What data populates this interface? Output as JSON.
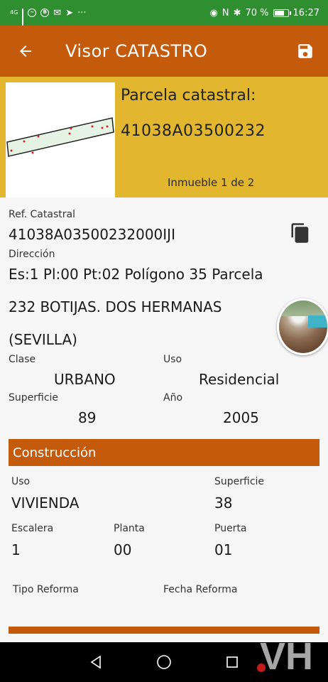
{
  "status_bar": {
    "network": "4G",
    "battery_percent": "70 %",
    "time": "16:27"
  },
  "app_bar": {
    "title": "Visor CATASTRO",
    "back_icon": "arrow-left-icon",
    "save_icon": "save-icon",
    "color": "#c35a0c"
  },
  "parcel": {
    "title": "Parcela catastral:",
    "code": "41038A03500232",
    "inmueble": "Inmueble 1 de 2",
    "header_color": "#e2b62f"
  },
  "details": {
    "ref_label": "Ref. Catastral",
    "ref_value": "41038A03500232000IJI",
    "direccion_label": "Dirección",
    "direccion_line1": "Es:1 Pl:00 Pt:02 Polígono 35 Parcela",
    "direccion_line2": "232 BOTIJAS. DOS HERMANAS",
    "direccion_line3": "(SEVILLA)",
    "clase_label": "Clase",
    "clase_value": "URBANO",
    "uso_label": "Uso",
    "uso_value": "Residencial",
    "superficie_label": "Superficie",
    "superficie_value": "89",
    "anio_label": "Año",
    "anio_value": "2005"
  },
  "construccion": {
    "title": "Construcción",
    "uso_label": "Uso",
    "uso_value": "VIVIENDA",
    "superficie_label": "Superficie",
    "superficie_value": "38",
    "escalera_label": "Escalera",
    "escalera_value": "1",
    "planta_label": "Planta",
    "planta_value": "00",
    "puerta_label": "Puerta",
    "puerta_value": "01",
    "tipo_reforma_label": "Tipo Reforma",
    "fecha_reforma_label": "Fecha Reforma"
  },
  "watermark": "VH"
}
